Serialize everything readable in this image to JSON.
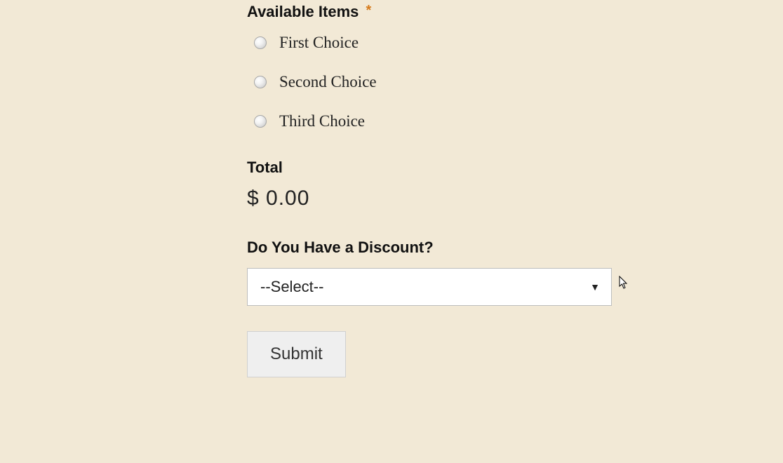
{
  "available_items": {
    "label": "Available Items",
    "required_mark": "*",
    "options": [
      {
        "label": "First Choice"
      },
      {
        "label": "Second Choice"
      },
      {
        "label": "Third Choice"
      }
    ]
  },
  "total": {
    "label": "Total",
    "value": "$ 0.00"
  },
  "discount": {
    "label": "Do You Have a Discount?",
    "selected": "--Select--"
  },
  "submit": {
    "label": "Submit"
  }
}
